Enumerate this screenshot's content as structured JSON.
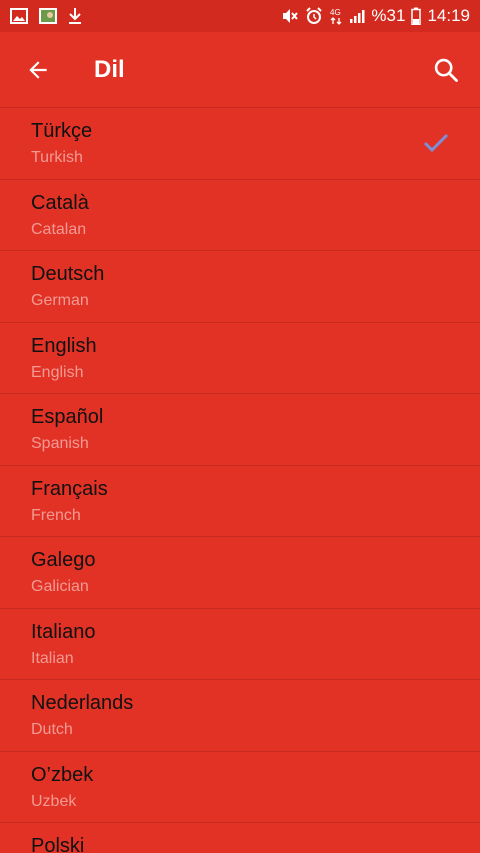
{
  "status_bar": {
    "battery": "%31",
    "time": "14:19",
    "network": "4G"
  },
  "app_bar": {
    "title": "Dil"
  },
  "languages": [
    {
      "name": "Türkçe",
      "english": "Turkish",
      "selected": true
    },
    {
      "name": "Català",
      "english": "Catalan",
      "selected": false
    },
    {
      "name": "Deutsch",
      "english": "German",
      "selected": false
    },
    {
      "name": "English",
      "english": "English",
      "selected": false
    },
    {
      "name": "Español",
      "english": "Spanish",
      "selected": false
    },
    {
      "name": "Français",
      "english": "French",
      "selected": false
    },
    {
      "name": "Galego",
      "english": "Galician",
      "selected": false
    },
    {
      "name": "Italiano",
      "english": "Italian",
      "selected": false
    },
    {
      "name": "Nederlands",
      "english": "Dutch",
      "selected": false
    },
    {
      "name": "O’zbek",
      "english": "Uzbek",
      "selected": false
    },
    {
      "name": "Polski",
      "english": "",
      "selected": false
    }
  ],
  "colors": {
    "background": "#e23226",
    "status_bar": "#d22a1e",
    "primary_text": "#111111",
    "secondary_text": "#f29a93",
    "check": "#7b8fd6"
  },
  "icons": {
    "back": "arrow-back-icon",
    "search": "search-icon",
    "check": "check-icon"
  }
}
